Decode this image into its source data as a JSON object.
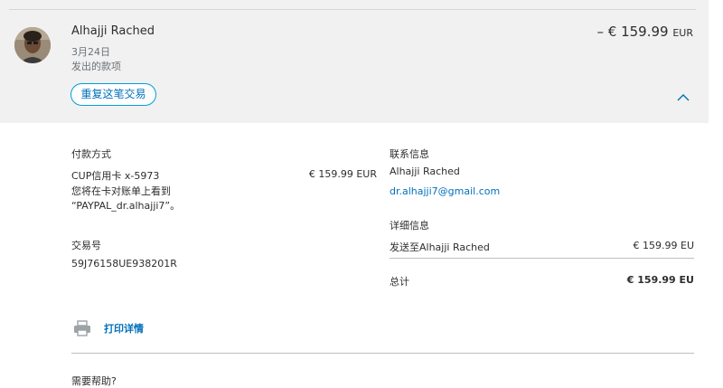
{
  "transaction": {
    "name": "Alhajji Rached",
    "date": "3月24日",
    "type": "发出的款项",
    "amount": "– € 159.99",
    "currency": "EUR",
    "repeat_label": "重复这笔交易",
    "collapse_icon": "chevron-up-icon"
  },
  "payment": {
    "heading": "付款方式",
    "method": "CUP信用卡 x-5973",
    "amount": "€ 159.99 EUR",
    "statement_line1": "您将在卡对账单上看到",
    "statement_line2": "“PAYPAL_dr.alhajji7”。"
  },
  "contact": {
    "heading": "联系信息",
    "name": "Alhajji Rached",
    "email": "dr.alhajji7@gmail.com"
  },
  "transaction_id": {
    "heading": "交易号",
    "value": "59J76158UE938201R"
  },
  "details": {
    "heading": "详细信息",
    "line_label": "发送至Alhajji Rached",
    "line_amount": "€ 159.99 EU",
    "total_label": "总计",
    "total_amount": "€ 159.99 EU"
  },
  "actions": {
    "print_label": "打印详情",
    "print_icon": "printer-icon"
  },
  "footer": {
    "help_label": "需要帮助?"
  },
  "colors": {
    "accent": "#0070ba",
    "header_bg": "#f1f1f1",
    "button_border": "#009cde"
  }
}
